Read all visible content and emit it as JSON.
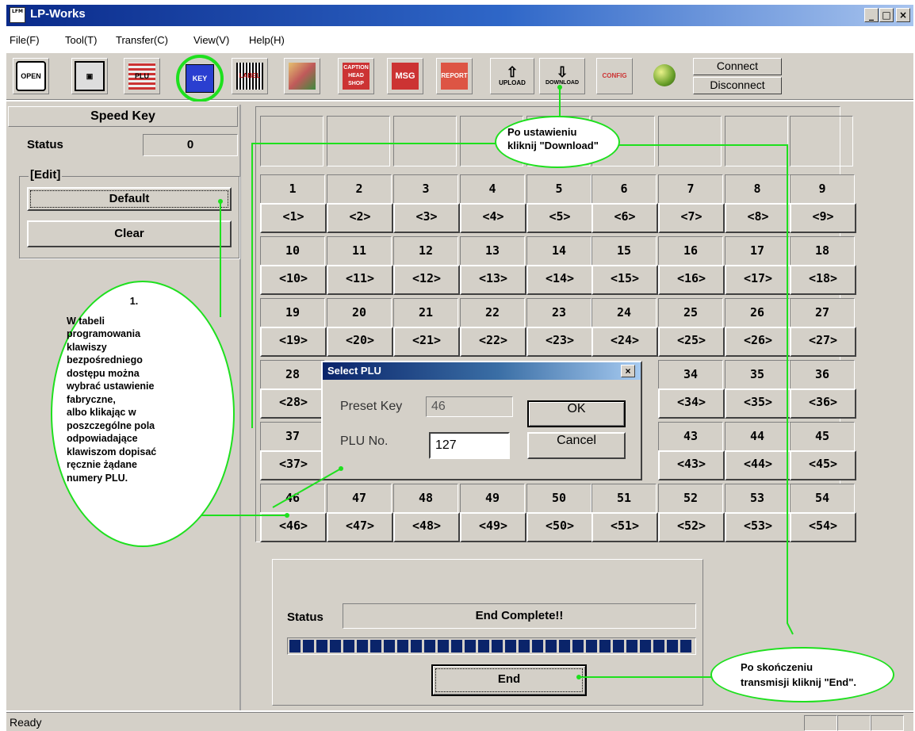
{
  "window": {
    "app_icon_text": "LFM",
    "title": "LP-Works",
    "minimize": "_",
    "maximize": "□",
    "close": "×"
  },
  "menu": [
    "File(F)",
    "Tool(T)",
    "Transfer(C)",
    "View(V)",
    "Help(H)"
  ],
  "toolbar": {
    "open": "OPEN",
    "plu": "PLU",
    "key": "KEY",
    "label": "LABEL",
    "caption": "CAPTION HEAD SHOP",
    "msg": "MSG",
    "report": "REPORT",
    "upload": "UPLOAD",
    "download": "DOWNLOAD",
    "config": "CONFIG",
    "connect": "Connect",
    "disconnect": "Disconnect"
  },
  "left_panel": {
    "title": "Speed Key",
    "status_label": "Status",
    "status_value": "0",
    "edit_group": "[Edit]",
    "default_button": "Default",
    "clear_button": "Clear"
  },
  "grid": {
    "rows": [
      {
        "nums": [
          "1",
          "2",
          "3",
          "4",
          "5",
          "6",
          "7",
          "8",
          "9"
        ],
        "labels": [
          "<1>",
          "<2>",
          "<3>",
          "<4>",
          "<5>",
          "<6>",
          "<7>",
          "<8>",
          "<9>"
        ]
      },
      {
        "nums": [
          "10",
          "11",
          "12",
          "13",
          "14",
          "15",
          "16",
          "17",
          "18"
        ],
        "labels": [
          "<10>",
          "<11>",
          "<12>",
          "<13>",
          "<14>",
          "<15>",
          "<16>",
          "<17>",
          "<18>"
        ]
      },
      {
        "nums": [
          "19",
          "20",
          "21",
          "22",
          "23",
          "24",
          "25",
          "26",
          "27"
        ],
        "labels": [
          "<19>",
          "<20>",
          "<21>",
          "<22>",
          "<23>",
          "<24>",
          "<25>",
          "<26>",
          "<27>"
        ]
      },
      {
        "nums": [
          "28",
          "",
          "",
          "",
          "",
          "",
          "34",
          "35",
          "36"
        ],
        "labels": [
          "<28>",
          "",
          "",
          "",
          "",
          "",
          "<34>",
          "<35>",
          "<36>"
        ]
      },
      {
        "nums": [
          "37",
          "",
          "",
          "",
          "",
          "",
          "43",
          "44",
          "45"
        ],
        "labels": [
          "<37>",
          "",
          "",
          "",
          "",
          "",
          "<43>",
          "<44>",
          "<45>"
        ]
      },
      {
        "nums": [
          "46",
          "47",
          "48",
          "49",
          "50",
          "51",
          "52",
          "53",
          "54"
        ],
        "labels": [
          "<46>",
          "<47>",
          "<48>",
          "<49>",
          "<50>",
          "<51>",
          "<52>",
          "<53>",
          "<54>"
        ]
      }
    ]
  },
  "dialog": {
    "title": "Select PLU",
    "close": "×",
    "preset_key_label": "Preset Key",
    "preset_key_value": "46",
    "plu_no_label": "PLU No.",
    "plu_no_value": "127",
    "ok": "OK",
    "cancel": "Cancel"
  },
  "status_panel": {
    "label": "Status",
    "value": "End Complete!!",
    "progress": 1.0,
    "end_button": "End"
  },
  "callouts": {
    "download_line1": "Po ustawieniu",
    "download_line2": "kliknij \"Download\"",
    "edit_num": "1.",
    "edit_lines": [
      "W tabeli",
      "programowania",
      "klawiszy",
      "bezpośredniego",
      "dostępu można",
      "wybrać ustawienie",
      "fabryczne,",
      "albo klikając w",
      "poszczególne pola",
      "odpowiadające",
      "klawiszom dopisać",
      "ręcznie żądane",
      "numery PLU."
    ],
    "end_line1": "Po skończeniu",
    "end_line2": "transmisji kliknij \"End\"."
  },
  "statusbar": {
    "text": "Ready"
  },
  "colors": {
    "accent_green": "#1ee01e",
    "title_blue": "#0a246a",
    "progress_blue": "#0a246a"
  }
}
